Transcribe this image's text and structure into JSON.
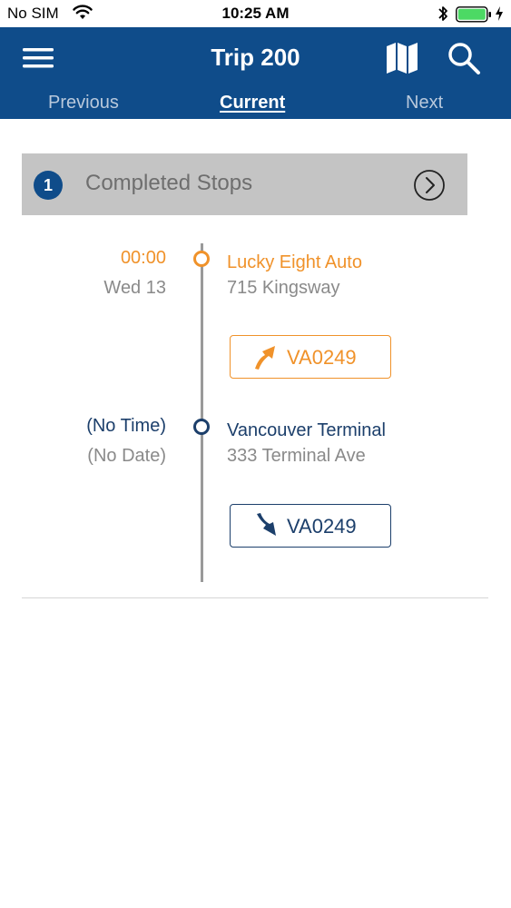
{
  "status_bar": {
    "carrier": "No SIM",
    "time": "10:25 AM"
  },
  "header": {
    "title": "Trip 200",
    "tabs": {
      "previous": "Previous",
      "current": "Current",
      "next": "Next"
    }
  },
  "completed_stops": {
    "count": "1",
    "label": "Completed Stops"
  },
  "stops": [
    {
      "time": "00:00",
      "date": "Wed 13",
      "name": "Lucky Eight Auto",
      "address": "715 Kingsway",
      "action": "pickup",
      "button_label": "VA0249",
      "color": "#f0922a"
    },
    {
      "time": "(No Time)",
      "date": "(No Date)",
      "name": "Vancouver Terminal",
      "address": "333 Terminal Ave",
      "action": "dropoff",
      "button_label": "VA0249",
      "color": "#1c3f6b"
    }
  ],
  "colors": {
    "brand": "#0f4c8a",
    "pickup": "#f0922a",
    "dropoff": "#1c3f6b",
    "banner": "#c4c4c4",
    "battery": "#4cd964"
  },
  "icons": {
    "menu": "menu-icon",
    "map": "map-icon",
    "search": "search-icon",
    "pickup": "arrow-up-right-icon",
    "dropoff": "arrow-down-right-icon",
    "completed": "chevron-right-circle-icon"
  }
}
